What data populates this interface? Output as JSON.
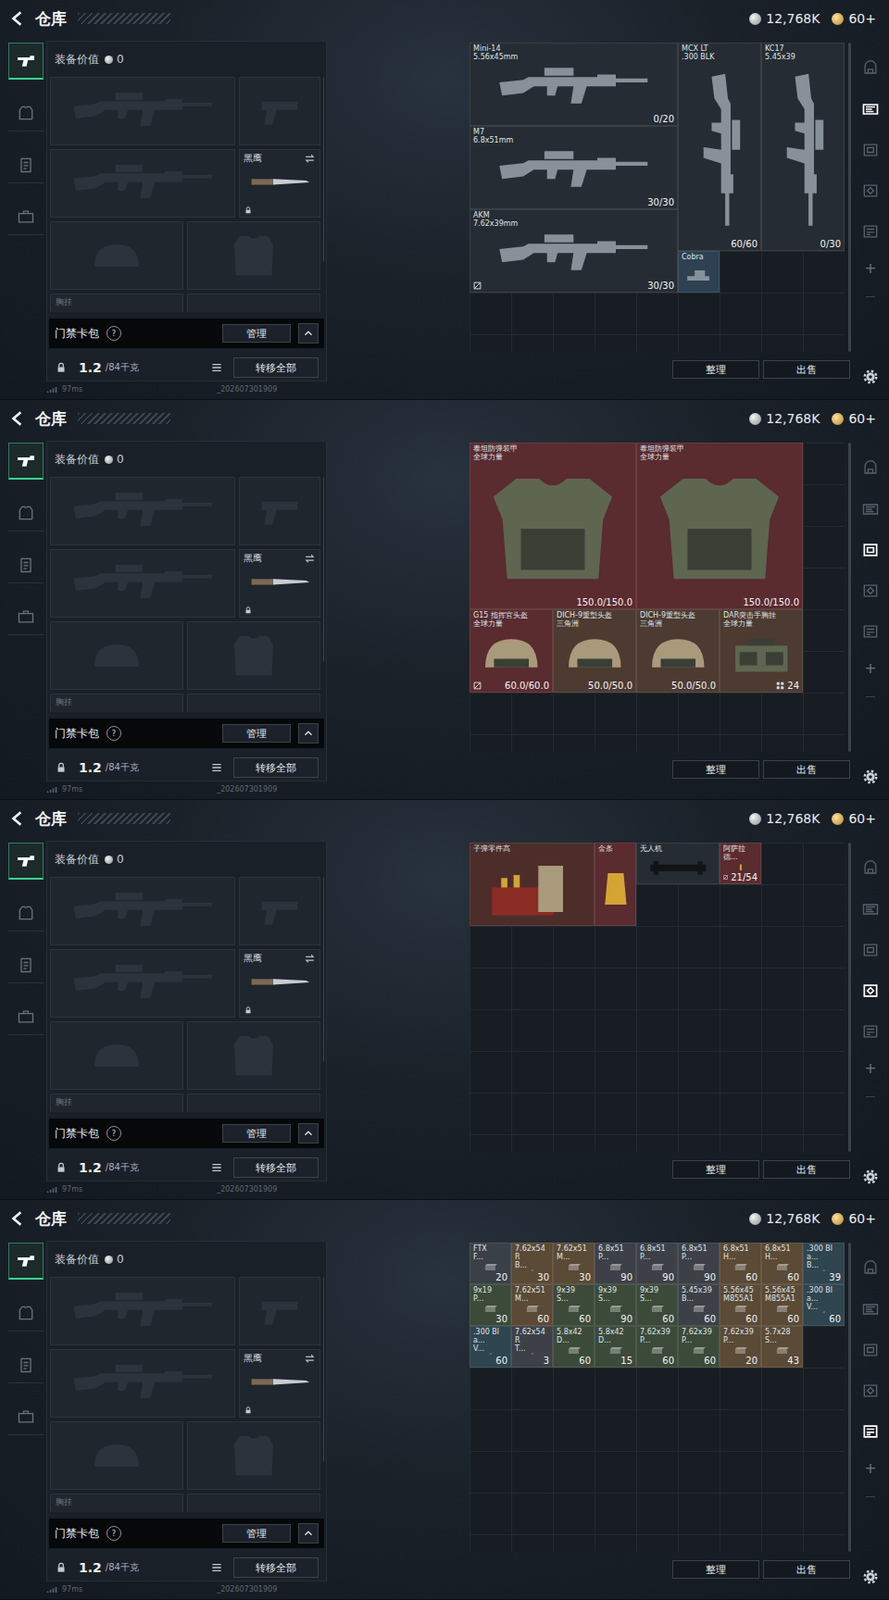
{
  "panels": [
    {
      "header": {
        "title": "仓库",
        "currency": "12,768K",
        "gold": "60+"
      },
      "side_tabs": [
        {
          "selected": true
        },
        {
          "selected": false
        },
        {
          "selected": false
        },
        {
          "selected": false
        }
      ],
      "loadout": {
        "value_label": "装备价值",
        "value": "0",
        "knife": "黑鹰",
        "rig_label": "胸挂",
        "card_pack": "门禁卡包",
        "help": "?",
        "manage": "管理",
        "weight": "1.2",
        "capacity": "/84千克",
        "transfer": "转移全部"
      },
      "status": {
        "ping": "97ms",
        "build": "_202607301909"
      },
      "storage": {
        "sort": "整理",
        "sell": "出售",
        "items": [
          {
            "kind": "rifle",
            "name": "Mini-14",
            "sub": "5.56x45mm",
            "count": "0/20",
            "color": "#262c33",
            "tagged": false
          },
          {
            "kind": "rifle",
            "name": "MCX LT",
            "sub": ".300 BLK",
            "count": "60/60",
            "color": "#262c33",
            "tagged": false
          },
          {
            "kind": "rifle",
            "name": "KC17",
            "sub": "5.45x39",
            "count": "0/30",
            "color": "#262c33",
            "tagged": false
          },
          {
            "kind": "rifle",
            "name": "M7",
            "sub": "6.8x51mm",
            "count": "30/30",
            "color": "#262c33",
            "tagged": false
          },
          {
            "kind": "rifle",
            "name": "AKM",
            "sub": "7.62x39mm",
            "count": "30/30",
            "color": "#262c33",
            "tagged": true
          },
          {
            "kind": "scope",
            "name": "Cobra",
            "sub": "",
            "count": "",
            "color": "#2d4152",
            "tagged": false
          }
        ]
      },
      "storage_tabs": [
        {
          "selected": false
        },
        {
          "selected": true
        },
        {
          "selected": false
        },
        {
          "selected": false
        },
        {
          "selected": false
        }
      ],
      "add": "+"
    },
    {
      "header": {
        "title": "仓库",
        "currency": "12,768K",
        "gold": "60+"
      },
      "side_tabs": [
        {
          "selected": true
        },
        {
          "selected": false
        },
        {
          "selected": false
        },
        {
          "selected": false
        }
      ],
      "loadout": {
        "value_label": "装备价值",
        "value": "0",
        "knife": "黑鹰",
        "rig_label": "胸挂",
        "card_pack": "门禁卡包",
        "help": "?",
        "manage": "管理",
        "weight": "1.2",
        "capacity": "/84千克",
        "transfer": "转移全部"
      },
      "status": {
        "ping": "97ms",
        "build": "_202607301909"
      },
      "storage": {
        "sort": "整理",
        "sell": "出售",
        "items": [
          {
            "kind": "armor",
            "name": "泰坦防弹装甲",
            "sub": "全球力量",
            "count": "150.0/150.0",
            "color": "#5a2b2f",
            "tagged": false
          },
          {
            "kind": "armor",
            "name": "泰坦防弹装甲",
            "sub": "全球力量",
            "count": "150.0/150.0",
            "color": "#5a2b2f",
            "tagged": false
          },
          {
            "kind": "helmet",
            "name": "G15 指挥官头盔",
            "sub": "全球力量",
            "count": "60.0/60.0",
            "color": "#5a2b2f",
            "tagged": true
          },
          {
            "kind": "helmet",
            "name": "DICH-9重型头盔",
            "sub": "三角洲",
            "count": "50.0/50.0",
            "color": "#4d3a30",
            "tagged": false
          },
          {
            "kind": "helmet",
            "name": "DICH-9重型头盔",
            "sub": "三角洲",
            "count": "50.0/50.0",
            "color": "#4d3a30",
            "tagged": false
          },
          {
            "kind": "rig",
            "name": "DAR突击手胸挂",
            "sub": "全球力量",
            "count": "24",
            "color": "#4d3a30",
            "tagged": false
          }
        ]
      },
      "storage_tabs": [
        {
          "selected": false
        },
        {
          "selected": false
        },
        {
          "selected": true
        },
        {
          "selected": false
        },
        {
          "selected": false
        }
      ],
      "add": "+"
    },
    {
      "header": {
        "title": "仓库",
        "currency": "12,768K",
        "gold": "60+"
      },
      "side_tabs": [
        {
          "selected": true
        },
        {
          "selected": false
        },
        {
          "selected": false
        },
        {
          "selected": false
        }
      ],
      "loadout": {
        "value_label": "装备价值",
        "value": "0",
        "knife": "黑鹰",
        "rig_label": "胸挂",
        "card_pack": "门禁卡包",
        "help": "?",
        "manage": "管理",
        "weight": "1.2",
        "capacity": "/84千克",
        "transfer": "转移全部"
      },
      "status": {
        "ping": "97ms",
        "build": "_202607301909"
      },
      "storage": {
        "sort": "整理",
        "sell": "出售",
        "items": [
          {
            "kind": "parts",
            "name": "子弹零件高",
            "sub": "",
            "count": "",
            "color": "#4d2d2a",
            "tagged": false
          },
          {
            "kind": "gold",
            "name": "金条",
            "sub": "",
            "count": "",
            "color": "#5a2b2f",
            "tagged": false
          },
          {
            "kind": "drone",
            "name": "无人机",
            "sub": "",
            "count": "",
            "color": "#262c33",
            "tagged": false
          },
          {
            "kind": "cartridge",
            "name": "阿萨拉德...",
            "sub": "",
            "count": "21/54",
            "color": "#5a2b2f",
            "tagged": true
          }
        ]
      },
      "storage_tabs": [
        {
          "selected": false
        },
        {
          "selected": false
        },
        {
          "selected": false
        },
        {
          "selected": true
        },
        {
          "selected": false
        }
      ],
      "add": "+"
    },
    {
      "header": {
        "title": "仓库",
        "currency": "12,768K",
        "gold": "60+"
      },
      "side_tabs": [
        {
          "selected": true
        },
        {
          "selected": false
        },
        {
          "selected": false
        },
        {
          "selected": false
        }
      ],
      "loadout": {
        "value_label": "装备价值",
        "value": "0",
        "knife": "黑鹰",
        "rig_label": "胸挂",
        "card_pack": "门禁卡包",
        "help": "?",
        "manage": "管理",
        "weight": "1.2",
        "capacity": "/84千克",
        "transfer": "转移全部"
      },
      "status": {
        "ping": "97ms",
        "build": "_202607301909"
      },
      "storage": {
        "sort": "整理",
        "sell": "出售",
        "items": [
          {
            "kind": "ammo",
            "name": "FTX",
            "sub": "F...",
            "count": "20",
            "color": "#3a4048",
            "tagged": false
          },
          {
            "kind": "ammo",
            "name": "7.62x54R",
            "sub": "B...",
            "count": "30",
            "color": "#5a4a36",
            "tagged": false
          },
          {
            "kind": "ammo",
            "name": "7.62x51",
            "sub": "M...",
            "count": "30",
            "color": "#5a4a36",
            "tagged": false
          },
          {
            "kind": "ammo",
            "name": "6.8x51",
            "sub": "P...",
            "count": "90",
            "color": "#3d4147",
            "tagged": false
          },
          {
            "kind": "ammo",
            "name": "6.8x51",
            "sub": "P...",
            "count": "90",
            "color": "#3d4147",
            "tagged": false
          },
          {
            "kind": "ammo",
            "name": "6.8x51",
            "sub": "P...",
            "count": "90",
            "color": "#3d4147",
            "tagged": false
          },
          {
            "kind": "ammo",
            "name": "6.8x51",
            "sub": "H...",
            "count": "60",
            "color": "#5a4a36",
            "tagged": false
          },
          {
            "kind": "ammo",
            "name": "6.8x51",
            "sub": "H...",
            "count": "60",
            "color": "#5a4a36",
            "tagged": false
          },
          {
            "kind": "ammo",
            "name": ".300 Bla...",
            "sub": "B...",
            "count": "39",
            "color": "#2f4550",
            "tagged": false
          },
          {
            "kind": "ammo",
            "name": "9x19",
            "sub": "P...",
            "count": "30",
            "color": "#3c4a3a",
            "tagged": false
          },
          {
            "kind": "ammo",
            "name": "7.62x51",
            "sub": "M...",
            "count": "60",
            "color": "#5a4a36",
            "tagged": false
          },
          {
            "kind": "ammo",
            "name": "9x39",
            "sub": "S...",
            "count": "60",
            "color": "#3c4a3a",
            "tagged": false
          },
          {
            "kind": "ammo",
            "name": "9x39",
            "sub": "S...",
            "count": "90",
            "color": "#3c4a3a",
            "tagged": false
          },
          {
            "kind": "ammo",
            "name": "9x39",
            "sub": "S...",
            "count": "60",
            "color": "#3c4a3a",
            "tagged": false
          },
          {
            "kind": "ammo",
            "name": "5.45x39",
            "sub": "B...",
            "count": "60",
            "color": "#3d4147",
            "tagged": false
          },
          {
            "kind": "ammo",
            "name": "5.56x45",
            "sub": "M855A1",
            "count": "60",
            "color": "#5a4a36",
            "tagged": false
          },
          {
            "kind": "ammo",
            "name": "5.56x45",
            "sub": "M855A1",
            "count": "60",
            "color": "#5a4a36",
            "tagged": false
          },
          {
            "kind": "ammo",
            "name": ".300 Bla...",
            "sub": "V...",
            "count": "60",
            "color": "#2f4550",
            "tagged": false
          },
          {
            "kind": "ammo",
            "name": ".300 Bla...",
            "sub": "V...",
            "count": "60",
            "color": "#2f4550",
            "tagged": false
          },
          {
            "kind": "ammo",
            "name": "7.62x54R",
            "sub": "T...",
            "count": "3",
            "color": "#3d4147",
            "tagged": false
          },
          {
            "kind": "ammo",
            "name": "5.8x42",
            "sub": "D...",
            "count": "60",
            "color": "#3c4a3a",
            "tagged": false
          },
          {
            "kind": "ammo",
            "name": "5.8x42",
            "sub": "D...",
            "count": "15",
            "color": "#3c4a3a",
            "tagged": false
          },
          {
            "kind": "ammo",
            "name": "7.62x39",
            "sub": "P...",
            "count": "60",
            "color": "#3c4a3a",
            "tagged": false
          },
          {
            "kind": "ammo",
            "name": "7.62x39",
            "sub": "P...",
            "count": "60",
            "color": "#3c4a3a",
            "tagged": false
          },
          {
            "kind": "ammo",
            "name": "7.62x39",
            "sub": "P...",
            "count": "20",
            "color": "#5a4a36",
            "tagged": false
          },
          {
            "kind": "ammo",
            "name": "5.7x28",
            "sub": "S...",
            "count": "43",
            "color": "#5a4a36",
            "tagged": false
          }
        ]
      },
      "storage_tabs": [
        {
          "selected": false
        },
        {
          "selected": false
        },
        {
          "selected": false
        },
        {
          "selected": false
        },
        {
          "selected": true
        }
      ],
      "add": "+"
    }
  ]
}
